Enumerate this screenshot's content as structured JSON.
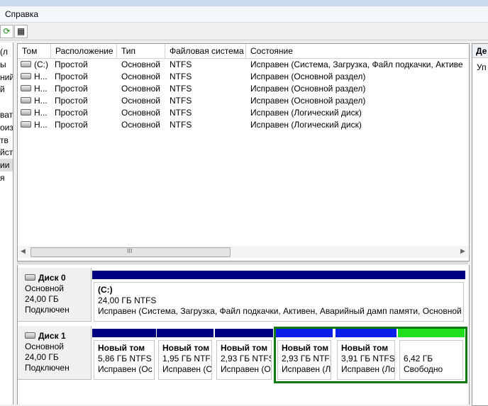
{
  "menu": {
    "help": "Справка"
  },
  "toolbar": {
    "refresh_icon": "refresh-icon",
    "properties_icon": "properties-icon"
  },
  "nav": {
    "items": [
      "(л",
      "ы",
      "ний",
      "й",
      "",
      "вате",
      "оиз",
      "тв",
      "йст",
      "ии",
      "я"
    ],
    "selected_index": 9
  },
  "volumes": {
    "columns": [
      "Том",
      "Расположение",
      "Тип",
      "Файловая система",
      "Состояние"
    ],
    "rows": [
      {
        "name": "(C:)",
        "layout": "Простой",
        "type": "Основной",
        "fs": "NTFS",
        "status": "Исправен (Система, Загрузка, Файл подкачки, Активен, А"
      },
      {
        "name": "Н...",
        "layout": "Простой",
        "type": "Основной",
        "fs": "NTFS",
        "status": "Исправен (Основной раздел)"
      },
      {
        "name": "Н...",
        "layout": "Простой",
        "type": "Основной",
        "fs": "NTFS",
        "status": "Исправен (Основной раздел)"
      },
      {
        "name": "Н...",
        "layout": "Простой",
        "type": "Основной",
        "fs": "NTFS",
        "status": "Исправен (Основной раздел)"
      },
      {
        "name": "Н...",
        "layout": "Простой",
        "type": "Основной",
        "fs": "NTFS",
        "status": "Исправен (Логический диск)"
      },
      {
        "name": "Н...",
        "layout": "Простой",
        "type": "Основной",
        "fs": "NTFS",
        "status": "Исправен (Логический диск)"
      }
    ],
    "scroll_grip": "III"
  },
  "disks": [
    {
      "name": "Диск 0",
      "type": "Основной",
      "size": "24,00 ГБ",
      "state": "Подключен",
      "partitions": [
        {
          "name": "(C:)",
          "size": "24,00 ГБ NTFS",
          "status": "Исправен (Система, Загрузка, Файл подкачки, Активен, Аварийный дамп памяти, Основной",
          "kind": "primary"
        }
      ]
    },
    {
      "name": "Диск 1",
      "type": "Основной",
      "size": "24,00 ГБ",
      "state": "Подключен",
      "partitions": [
        {
          "name": "Новый том",
          "size": "5,86 ГБ NTFS",
          "status": "Исправен (Ос",
          "kind": "primary"
        },
        {
          "name": "Новый том",
          "size": "1,95 ГБ NTFS",
          "status": "Исправен (С",
          "kind": "primary"
        },
        {
          "name": "Новый том",
          "size": "2,93 ГБ NTFS",
          "status": "Исправен (О",
          "kind": "primary"
        },
        {
          "name": "Новый том",
          "size": "2,93 ГБ NTFS",
          "status": "Исправен (Л",
          "kind": "logical"
        },
        {
          "name": "Новый том",
          "size": "3,91 ГБ NTFS",
          "status": "Исправен (Ло",
          "kind": "logical"
        },
        {
          "name": "",
          "size": "6,42 ГБ",
          "status": "Свободно",
          "kind": "free"
        }
      ]
    }
  ],
  "actions": {
    "header": "Де",
    "item": "Уп"
  },
  "colors": {
    "primary": "#000080",
    "logical": "#0a1fe8",
    "free": "#1fe01f",
    "extended_border": "#0f7a0f"
  }
}
